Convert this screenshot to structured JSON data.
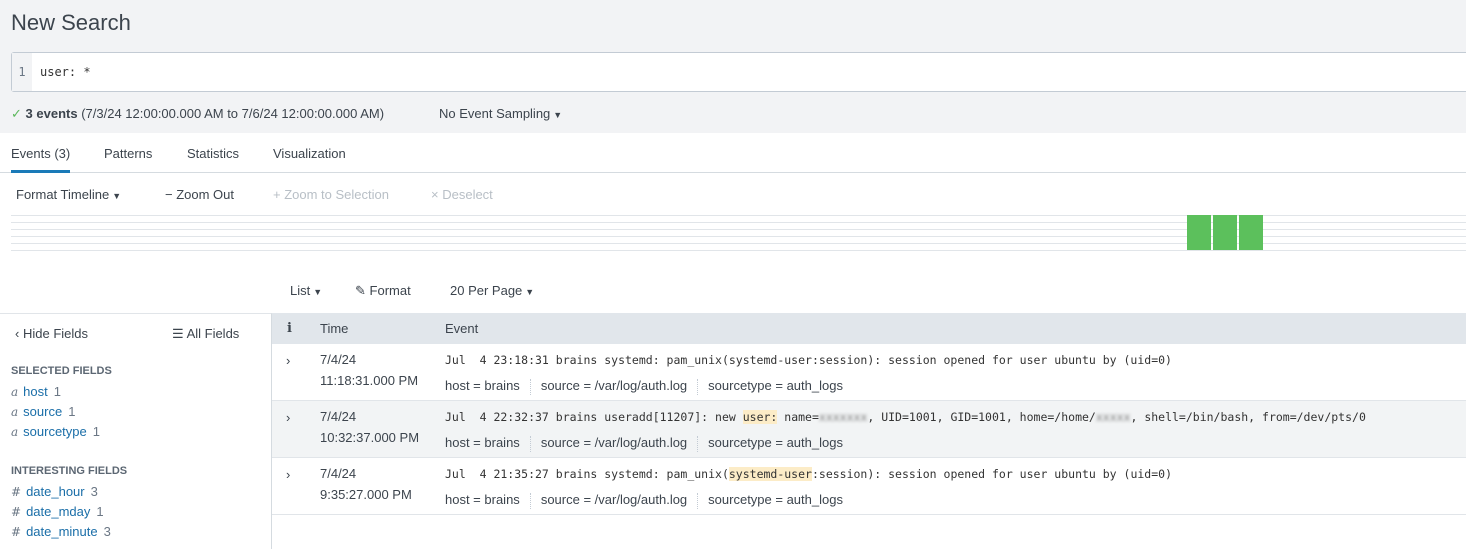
{
  "title": "New Search",
  "search": {
    "line_number": "1",
    "query": "user: *"
  },
  "status": {
    "count": "3 events",
    "range": "(7/3/24 12:00:00.000 AM to 7/6/24 12:00:00.000 AM)",
    "sampling": "No Event Sampling"
  },
  "tabs": [
    "Events (3)",
    "Patterns",
    "Statistics",
    "Visualization"
  ],
  "timeline": {
    "format": "Format Timeline",
    "zoom_out": "Zoom Out",
    "zoom_sel": "Zoom to Selection",
    "deselect": "Deselect",
    "bars": [
      1,
      1,
      1
    ],
    "bar_color": "#5cc05c"
  },
  "list_toolbar": {
    "list": "List",
    "format": "Format",
    "per_page": "20 Per Page"
  },
  "fields": {
    "hide": "Hide Fields",
    "all": "All Fields",
    "selected_header": "SELECTED FIELDS",
    "selected": [
      {
        "type": "a",
        "name": "host",
        "count": "1"
      },
      {
        "type": "a",
        "name": "source",
        "count": "1"
      },
      {
        "type": "a",
        "name": "sourcetype",
        "count": "1"
      }
    ],
    "interesting_header": "INTERESTING FIELDS",
    "interesting": [
      {
        "type": "#",
        "name": "date_hour",
        "count": "3"
      },
      {
        "type": "#",
        "name": "date_mday",
        "count": "1"
      },
      {
        "type": "#",
        "name": "date_minute",
        "count": "3"
      }
    ]
  },
  "table": {
    "headers": {
      "info": "i",
      "time": "Time",
      "event": "Event"
    },
    "rows": [
      {
        "date": "7/4/24",
        "time": "11:18:31.000 PM",
        "raw_a": "Jul  4 23:18:31 brains systemd: pam_unix(systemd-user:session): session opened for user ubuntu by (uid=0)",
        "host": "brains",
        "source": "/var/log/auth.log",
        "sourcetype": "auth_logs"
      },
      {
        "date": "7/4/24",
        "time": "10:32:37.000 PM",
        "raw_a": "Jul  4 22:32:37 brains useradd[11207]: new ",
        "hl": "user:",
        "raw_b": " name=",
        "redact1": "xxxxxxx",
        "raw_c": ", UID=1001, GID=1001, home=/home/",
        "redact2": "xxxxx",
        "raw_d": ", shell=/bin/bash, from=/dev/pts/0",
        "host": "brains",
        "source": "/var/log/auth.log",
        "sourcetype": "auth_logs"
      },
      {
        "date": "7/4/24",
        "time": "9:35:27.000 PM",
        "raw_a": "Jul  4 21:35:27 brains systemd: pam_unix(",
        "hl": "systemd-user",
        "raw_b": ":session): session opened for user ubuntu by (uid=0)",
        "host": "brains",
        "source": "/var/log/auth.log",
        "sourcetype": "auth_logs"
      }
    ]
  }
}
